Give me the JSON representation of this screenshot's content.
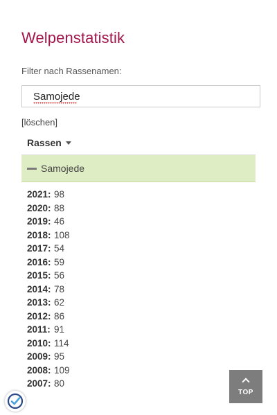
{
  "page": {
    "title": "Welpenstatistik"
  },
  "filter": {
    "label": "Filter nach Rassenamen:",
    "value": "Samojede",
    "clear_label": "[löschen]"
  },
  "table": {
    "sort_header": "Rassen",
    "breed": {
      "name": "Samojede",
      "expanded": true
    },
    "years": [
      {
        "year": "2021:",
        "count": "98"
      },
      {
        "year": "2020:",
        "count": "88"
      },
      {
        "year": "2019:",
        "count": "46"
      },
      {
        "year": "2018:",
        "count": "108"
      },
      {
        "year": "2017:",
        "count": "54"
      },
      {
        "year": "2016:",
        "count": "59"
      },
      {
        "year": "2015:",
        "count": "56"
      },
      {
        "year": "2014:",
        "count": "78"
      },
      {
        "year": "2013:",
        "count": "62"
      },
      {
        "year": "2012:",
        "count": "86"
      },
      {
        "year": "2011:",
        "count": "91"
      },
      {
        "year": "2010:",
        "count": "114"
      },
      {
        "year": "2009:",
        "count": "95"
      },
      {
        "year": "2008:",
        "count": "109"
      },
      {
        "year": "2007:",
        "count": "80"
      }
    ]
  },
  "back_to_top": {
    "label": "TOP",
    "icon": "chevron-up-icon"
  },
  "badge": {
    "icon": "verified-check-icon"
  },
  "colors": {
    "title": "#a3154a",
    "breed_row_bg": "#deedc3",
    "top_button_bg": "#7d7d7d"
  }
}
